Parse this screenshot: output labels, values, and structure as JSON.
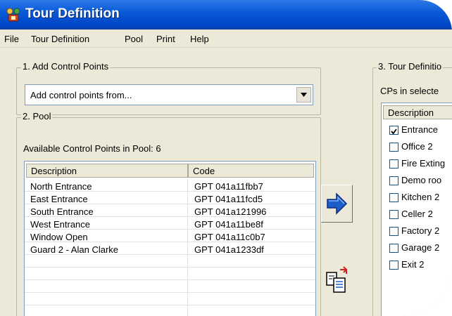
{
  "window": {
    "title": "Tour Definition"
  },
  "menu": [
    "File",
    "Tour Definition",
    "Pool",
    "Print",
    "Help"
  ],
  "add_section": {
    "label": "1. Add Control Points",
    "combo_value": "Add control points from..."
  },
  "pool_section": {
    "label": "2. Pool",
    "count_text": "Available Control Points in Pool: 6",
    "columns": [
      "Description",
      "Code"
    ],
    "rows": [
      {
        "description": "North Entrance",
        "code": "GPT 041a11fbb7"
      },
      {
        "description": "East Entrance",
        "code": "GPT 041a11fcd5"
      },
      {
        "description": "South Entrance",
        "code": "GPT 041a121996"
      },
      {
        "description": "West Entrance",
        "code": "GPT 041a11be8f"
      },
      {
        "description": "Window Open",
        "code": "GPT 041a11c0b7"
      },
      {
        "description": "Guard 2 - Alan Clarke",
        "code": "GPT 041a1233df"
      }
    ]
  },
  "tour_section": {
    "label": "3. Tour Definitio",
    "cps_label": "CPs in selecte",
    "column": "Description",
    "items": [
      {
        "label": "Entrance",
        "checked": true
      },
      {
        "label": "Office 2",
        "checked": false
      },
      {
        "label": "Fire Exting",
        "checked": false
      },
      {
        "label": "Demo roo",
        "checked": false
      },
      {
        "label": "Kitchen 2",
        "checked": false
      },
      {
        "label": "Celler 2",
        "checked": false
      },
      {
        "label": "Factory 2",
        "checked": false
      },
      {
        "label": "Garage 2",
        "checked": false
      },
      {
        "label": "Exit 2",
        "checked": false
      }
    ]
  },
  "icons": {
    "title": "tour-app-icon",
    "dropdown": "chevron-down-icon",
    "move": "arrow-right-icon",
    "copy": "copy-documents-icon",
    "check": "checkbox-icon"
  },
  "colors": {
    "titlebar": "#0a5bd8",
    "arrow": "#1e5cc8",
    "window": "#ece9d8"
  }
}
